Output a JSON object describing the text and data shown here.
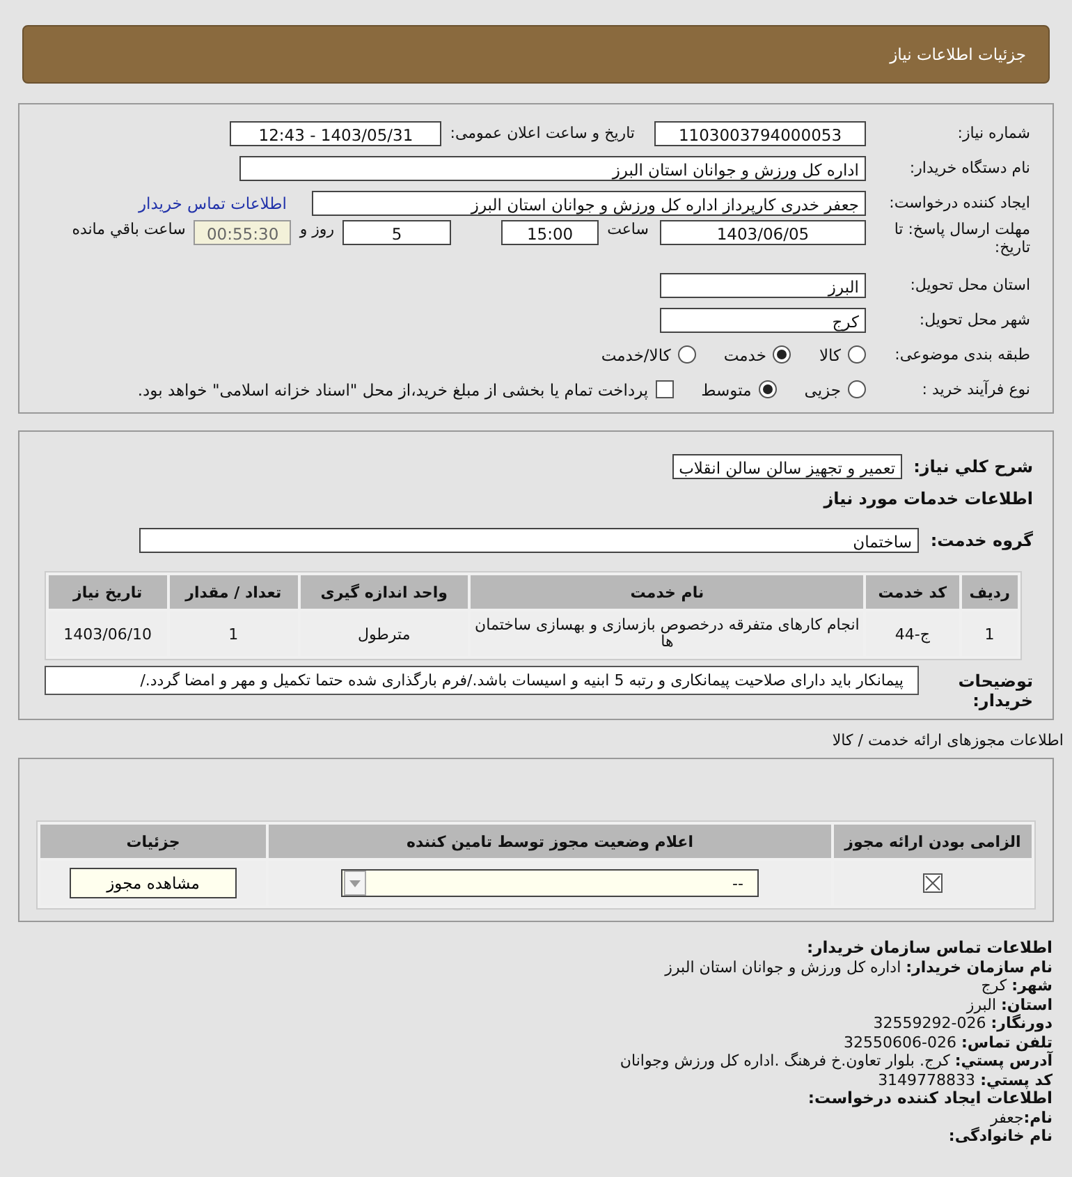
{
  "header": {
    "title": "جزئیات اطلاعات نیاز"
  },
  "need_number": {
    "label": "شماره نیاز:",
    "value": "1103003794000053"
  },
  "announce_datetime": {
    "label": "تاریخ و ساعت اعلان عمومی:",
    "value": "1403/05/31 - 12:43"
  },
  "buyer_org": {
    "label": "نام دستگاه خریدار:",
    "value": "اداره کل ورزش و جوانان استان البرز"
  },
  "requester": {
    "label": "ایجاد کننده درخواست:",
    "value": "جعفر خدری کارپرداز اداره کل ورزش و جوانان استان البرز",
    "link": "اطلاعات تماس خریدار"
  },
  "deadline": {
    "label": "مهلت ارسال پاسخ: تا تاریخ:",
    "date": "1403/06/05",
    "time_label": "ساعت",
    "time": "15:00",
    "days": "5",
    "days_label": "روز و",
    "remaining": "00:55:30",
    "remaining_label": "ساعت باقي مانده"
  },
  "province": {
    "label": "استان محل تحویل:",
    "value": "البرز"
  },
  "city": {
    "label": "شهر محل تحویل:",
    "value": "کرج"
  },
  "category": {
    "label": "طبقه بندی موضوعی:",
    "options": [
      {
        "label": "کالا",
        "selected": false
      },
      {
        "label": "خدمت",
        "selected": true
      },
      {
        "label": "کالا/خدمت",
        "selected": false
      }
    ]
  },
  "process": {
    "label": "نوع فرآیند خرید :",
    "options": [
      {
        "label": "جزیی",
        "selected": false
      },
      {
        "label": "متوسط",
        "selected": true
      }
    ],
    "payment_checkbox": {
      "label": "پرداخت تمام یا بخشی از مبلغ خرید،از محل \"اسناد خزانه اسلامی\" خواهد بود.",
      "checked": false
    }
  },
  "summary": {
    "label": "شرح کلي نياز:",
    "value": "تعمیر و تجهیز سالن سالن انقلاب"
  },
  "services": {
    "title": "اطلاعات خدمات مورد نیاز",
    "group_label": "گروه خدمت:",
    "group_value": "ساختمان",
    "columns": [
      "ردیف",
      "کد خدمت",
      "نام خدمت",
      "واحد اندازه گیری",
      "تعداد / مقدار",
      "تاریخ نیاز"
    ],
    "rows": [
      [
        "1",
        "ج-44",
        "انجام کارهای متفرقه درخصوص بازسازی و بهسازی ساختمان ها",
        "مترطول",
        "1",
        "1403/06/10"
      ]
    ]
  },
  "buyer_notes": {
    "label": "توضیحات خریدار:",
    "value": "پیمانکار باید دارای صلاحیت پیمانکاری و رتبه 5 ابنیه و اسیسات باشد./فرم بارگذاری شده حتما تکمیل و مهر و امضا گردد./"
  },
  "licenses": {
    "title": "اطلاعات مجوزهای ارائه خدمت / کالا",
    "columns": [
      "الزامی بودن ارائه مجوز",
      "اعلام وضعیت مجوز توسط تامین کننده",
      "جزئیات"
    ],
    "rows": [
      {
        "required": true,
        "status": "--",
        "button": "مشاهده مجوز"
      }
    ]
  },
  "contact": {
    "title": "اطلاعات تماس سازمان خریدار:",
    "items": [
      {
        "label": "نام سازمان خریدار:",
        "value": "اداره کل ورزش و جوانان استان البرز"
      },
      {
        "label": "شهر:",
        "value": "کرج"
      },
      {
        "label": "استان:",
        "value": "البرز"
      },
      {
        "label": "دورنگار:",
        "value": "026-32559292"
      },
      {
        "label": "تلفن تماس:",
        "value": "026-32550606"
      },
      {
        "label": "آدرس پستي:",
        "value": "کرج. بلوار تعاون.خ فرهنگ .اداره کل ورزش وجوانان"
      },
      {
        "label": "کد پستي:",
        "value": "3149778833"
      }
    ]
  },
  "creator": {
    "title": "اطلاعات ایجاد کننده درخواست:",
    "items": [
      {
        "label": "نام:",
        "value": "جعفر"
      },
      {
        "label": "نام خانوادگی:",
        "value": ""
      }
    ]
  }
}
